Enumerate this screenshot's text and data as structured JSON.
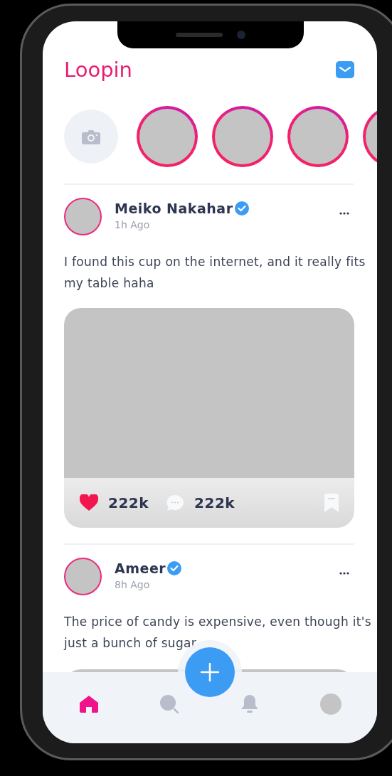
{
  "app": {
    "title": "Loopin"
  },
  "stories": [
    {
      "kind": "add"
    },
    {
      "kind": "story"
    },
    {
      "kind": "story"
    },
    {
      "kind": "story"
    },
    {
      "kind": "story"
    }
  ],
  "posts": [
    {
      "author": "Meiko Nakahar",
      "verified": true,
      "time": "1h Ago",
      "text": "I found this cup on the internet, and it really fits my table haha",
      "likes": "222k",
      "comments": "222k",
      "liked": true,
      "saved": false
    },
    {
      "author": "Ameer",
      "verified": true,
      "time": "8h Ago",
      "text": "The price of candy is expensive, even though it's just a bunch of sugar"
    }
  ],
  "nav": [
    {
      "kind": "home",
      "selected": true
    },
    {
      "kind": "search",
      "selected": false
    },
    {
      "kind": "add"
    },
    {
      "kind": "notifications",
      "selected": false
    },
    {
      "kind": "profile",
      "selected": false
    }
  ]
}
